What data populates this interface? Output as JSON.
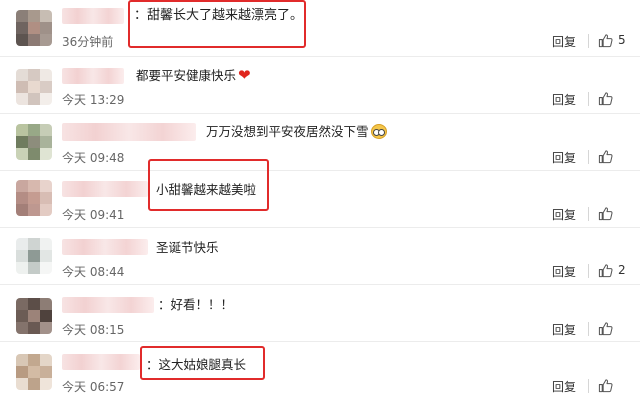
{
  "comments": [
    {
      "text": "：甜馨长大了越来越漂亮了。",
      "time": "36分钟前",
      "reply": "回复",
      "likes": "5",
      "emoji": ""
    },
    {
      "text": "都要平安健康快乐",
      "time": "今天 13:29",
      "reply": "回复",
      "likes": "",
      "emoji": "red-heart-emoji"
    },
    {
      "text": "万万没想到平安夜居然没下雪",
      "time": "今天 09:48",
      "reply": "回复",
      "likes": "",
      "emoji": "glasses-face-emoji"
    },
    {
      "text": "小甜馨越来越美啦",
      "time": "今天 09:41",
      "reply": "回复",
      "likes": "",
      "emoji": ""
    },
    {
      "text": "圣诞节快乐",
      "time": "今天 08:44",
      "reply": "回复",
      "likes": "2",
      "emoji": ""
    },
    {
      "text": "：好看！！！",
      "time": "今天 08:15",
      "reply": "回复",
      "likes": "",
      "emoji": ""
    },
    {
      "text": "：这大姑娘腿真长",
      "time": "今天 06:57",
      "reply": "回复",
      "likes": "",
      "emoji": ""
    }
  ],
  "colors": {
    "highlight_box": "#e12b2b",
    "name_blur": "#f2cccc",
    "heart": "#e0251d"
  },
  "icons": {
    "like": "thumbs-up-icon"
  }
}
